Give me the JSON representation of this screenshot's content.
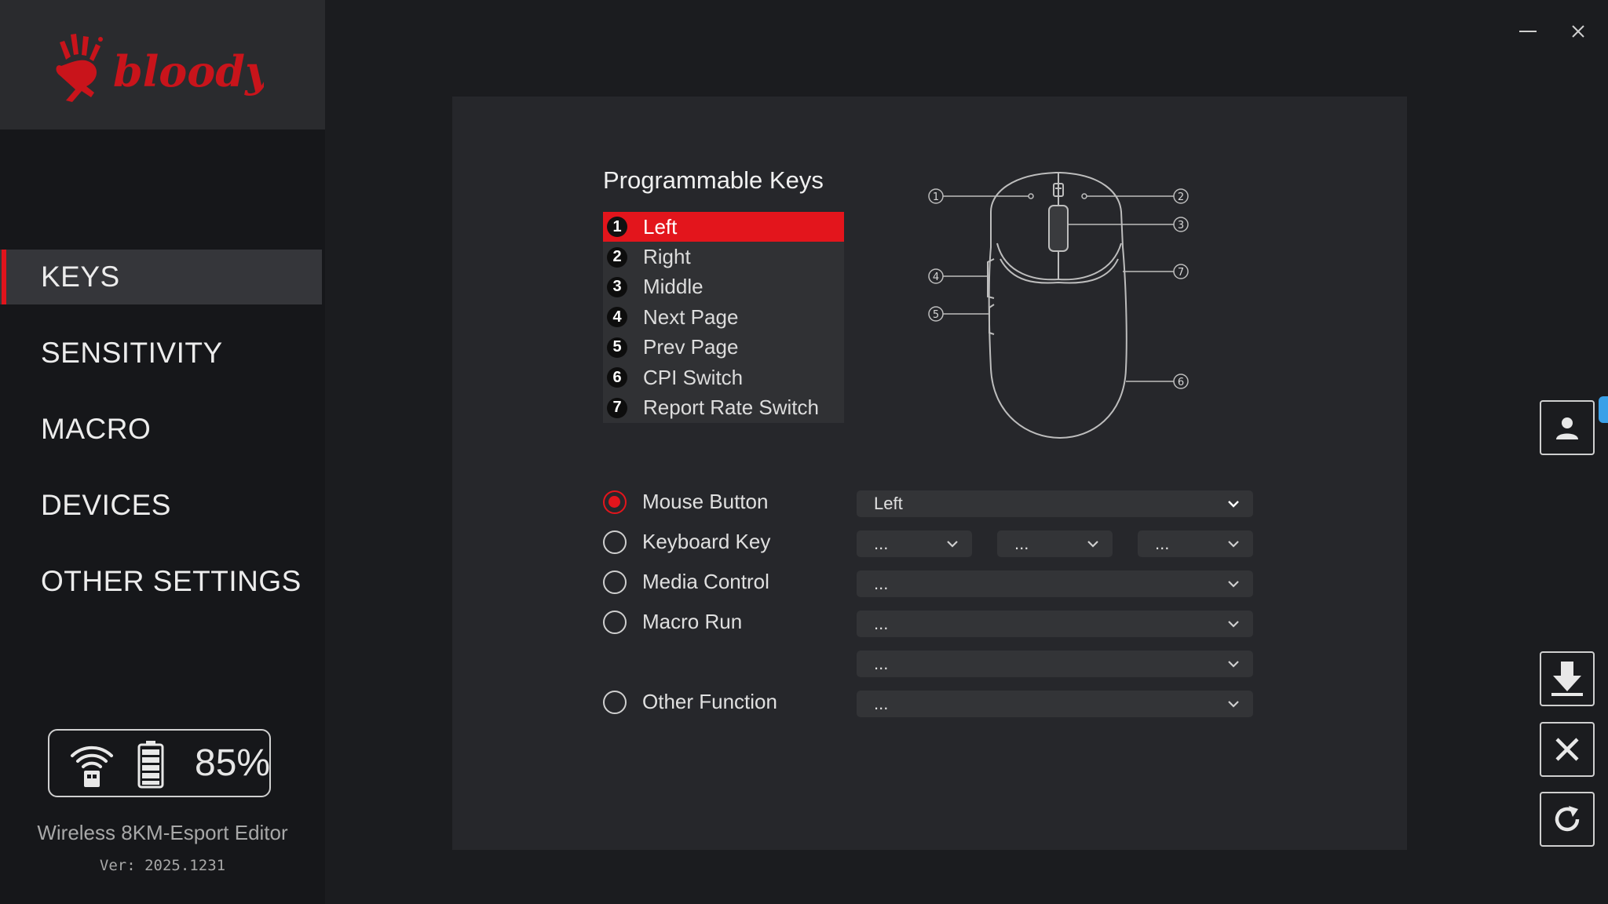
{
  "app": {
    "brand": "bloody",
    "window_controls": {
      "minimize": "minimize",
      "close": "close"
    }
  },
  "sidebar": {
    "nav": [
      {
        "label": "KEYS",
        "active": true
      },
      {
        "label": "SENSITIVITY",
        "active": false
      },
      {
        "label": "MACRO",
        "active": false
      },
      {
        "label": "DEVICES",
        "active": false
      },
      {
        "label": "OTHER SETTINGS",
        "active": false
      }
    ],
    "status": {
      "battery_percent": "85%",
      "icons": [
        "wireless-receiver-icon",
        "battery-icon"
      ]
    },
    "device_name": "Wireless 8KM-Esport Editor",
    "version": "Ver: 2025.1231"
  },
  "keys_panel": {
    "title": "Programmable Keys",
    "keys": [
      {
        "num": "1",
        "label": "Left",
        "selected": true
      },
      {
        "num": "2",
        "label": "Right",
        "selected": false
      },
      {
        "num": "3",
        "label": "Middle",
        "selected": false
      },
      {
        "num": "4",
        "label": "Next Page",
        "selected": false
      },
      {
        "num": "5",
        "label": "Prev Page",
        "selected": false
      },
      {
        "num": "6",
        "label": "CPI Switch",
        "selected": false
      },
      {
        "num": "7",
        "label": "Report Rate Switch",
        "selected": false
      }
    ],
    "diagram_labels": [
      "1",
      "2",
      "3",
      "4",
      "5",
      "6",
      "7"
    ]
  },
  "options": {
    "mouse_button": {
      "label": "Mouse Button",
      "checked": true,
      "value": "Left"
    },
    "keyboard_key": {
      "label": "Keyboard Key",
      "checked": false,
      "values": [
        "...",
        "...",
        "..."
      ]
    },
    "media_control": {
      "label": "Media Control",
      "checked": false,
      "value": "..."
    },
    "macro_run": {
      "label": "Macro Run",
      "checked": false,
      "value": "...",
      "value2": "..."
    },
    "other_function": {
      "label": "Other Function",
      "checked": false,
      "value": "..."
    }
  },
  "tools": [
    "user-profile-icon",
    "download-icon",
    "cancel-icon",
    "refresh-icon"
  ],
  "colors": {
    "accent": "#e3151c",
    "panel": "#26272b",
    "background": "#1b1c1f"
  }
}
